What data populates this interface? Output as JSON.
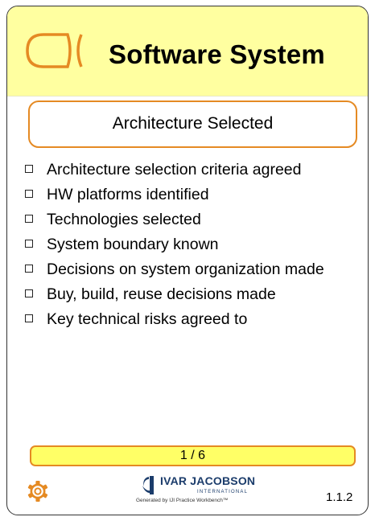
{
  "card": {
    "title": "Software System",
    "title_icon": "alpha-symbol-icon",
    "state": "Architecture Selected",
    "checklist": [
      "Architecture selection criteria agreed",
      "HW platforms identified",
      "Technologies selected",
      "System boundary known",
      "Decisions on system organization made",
      "Buy, build, reuse decisions made",
      "Key technical risks agreed to"
    ],
    "progress": "1 / 6",
    "footer": {
      "brand_name": "IVAR JACOBSON",
      "brand_sub": "INTERNATIONAL",
      "credit": "Generated by IJI Practice Workbench™",
      "version": "1.1.2",
      "gear_icon": "gear-icon"
    }
  },
  "colors": {
    "header_bg": "#ffffa0",
    "accent_orange": "#e58a23",
    "progress_bg": "#ffff66",
    "brand_navy": "#1b3c6b"
  }
}
